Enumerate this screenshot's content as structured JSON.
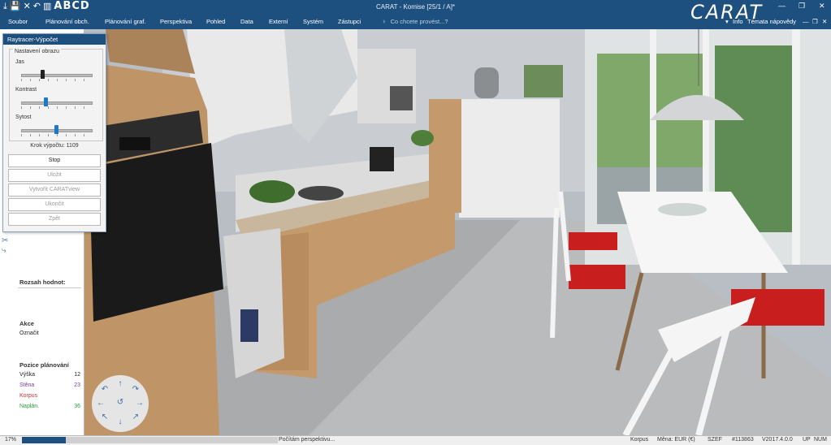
{
  "window": {
    "title": "CARAT - Komise [25/1 / A]*",
    "logo": "CARAT",
    "quick_access": [
      "⤓",
      "💾",
      "✕",
      "↶",
      "▥"
    ],
    "quick_access_letters": "ABCD",
    "controls": [
      "—",
      "❐",
      "✕"
    ],
    "sub_controls": [
      "—",
      "❐",
      "✕"
    ]
  },
  "menu": {
    "items": [
      "Soubor",
      "Plánování obch.",
      "Plánování graf.",
      "Perspektiva",
      "Pohled",
      "Data",
      "Externí",
      "Systém",
      "Zástupci"
    ],
    "search_placeholder": "Co chcete provést...?",
    "info": "Info",
    "help": "Témata nápovědy"
  },
  "dialog": {
    "title": "Raytracer-Výpočet",
    "group_title": "Nastavení obrazu",
    "sliders": [
      {
        "label": "Jas",
        "value": 0.3,
        "color": "#222222"
      },
      {
        "label": "Kontrast",
        "value": 0.35,
        "color": "#1f77c9"
      },
      {
        "label": "Sytost",
        "value": 0.5,
        "color": "#1f77c9"
      }
    ],
    "steps": "Krok výpočtu: 1109",
    "buttons": [
      {
        "label": "Stop",
        "enabled": true
      },
      {
        "label": "Uložit",
        "enabled": false
      },
      {
        "label": "Vytvořit CARATview",
        "enabled": false
      },
      {
        "label": "Ukončit",
        "enabled": false
      },
      {
        "label": "Zpět",
        "enabled": false
      }
    ]
  },
  "left_panel": {
    "range_title": "Rozsah hodnot:",
    "actions_title": "Akce",
    "action_item": "Označit",
    "position_title": "Pozice plánování",
    "rows": [
      {
        "label": "Výška",
        "value": "12",
        "color": "#222222"
      },
      {
        "label": "Stěna",
        "value": "23",
        "color": "#7b3fa0"
      },
      {
        "label": "Korpus",
        "value": "",
        "color": "#d0312d"
      },
      {
        "label": "Naplán.",
        "value": "36",
        "color": "#2e9a36"
      }
    ],
    "tool_icons": [
      "✂",
      "⤷"
    ]
  },
  "nav_wheel": {
    "icons": [
      "↶",
      "↑",
      "↷",
      "←",
      "↺",
      "→",
      "↖",
      "↓",
      "↗"
    ]
  },
  "statusbar": {
    "zoom": "17%",
    "progress": 0.17,
    "message": "Počítám perspektivu...",
    "korpus": "Korpus",
    "currency": "Měna: EUR (€)",
    "user": "SZEF",
    "order": "#113863",
    "version": "V2017.4.0.0",
    "up": "UP",
    "num": "NUM"
  }
}
